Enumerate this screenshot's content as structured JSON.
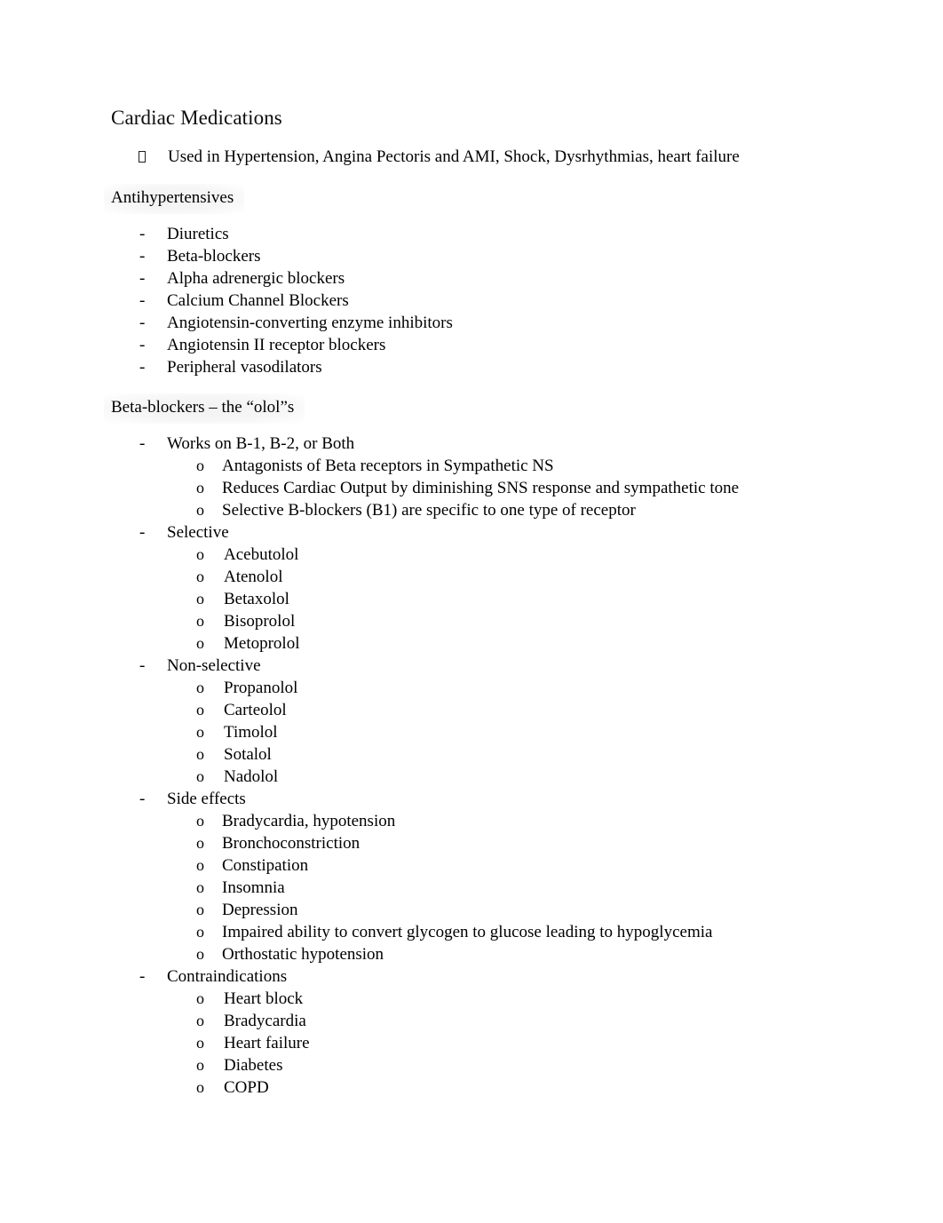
{
  "document": {
    "title": "Cardiac Medications",
    "intro": {
      "marker": "missing-glyph-box",
      "text": "Used in Hypertension, Angina Pectoris and AMI, Shock, Dysrhythmias, heart failure"
    },
    "sections": [
      {
        "heading": "Antihypertensives",
        "heading_shaded": true,
        "items": [
          {
            "marker": "-",
            "text": "Diuretics"
          },
          {
            "marker": "-",
            "text": "Beta-blockers"
          },
          {
            "marker": "-",
            "text": "Alpha adrenergic blockers"
          },
          {
            "marker": "-",
            "text": "Calcium Channel Blockers"
          },
          {
            "marker": "-",
            "text": "Angiotensin-converting enzyme inhibitors"
          },
          {
            "marker": "-",
            "text": "Angiotensin II receptor blockers"
          },
          {
            "marker": "-",
            "text": "Peripheral vasodilators"
          }
        ]
      },
      {
        "heading": "Beta-blockers – the “olol”s",
        "heading_shaded": true,
        "groups": [
          {
            "marker": "-",
            "text": "Works on B-1, B-2, or Both",
            "sub_marker": "o",
            "sub": [
              "Antagonists of Beta receptors in Sympathetic NS",
              "Reduces Cardiac Output by diminishing SNS response and sympathetic tone",
              "Selective B-blockers (B1) are specific to one type of receptor"
            ]
          },
          {
            "marker": "-",
            "text": "Selective",
            "sub_marker": "o",
            "sub": [
              "Acebutolol",
              "Atenolol",
              "Betaxolol",
              "Bisoprolol",
              "Metoprolol"
            ]
          },
          {
            "marker": "-",
            "text": "Non-selective",
            "sub_marker": "o",
            "sub": [
              "Propanolol",
              "Carteolol",
              "Timolol",
              "Sotalol",
              "Nadolol"
            ]
          },
          {
            "marker": "-",
            "text": "Side effects",
            "sub_marker": "o",
            "sub": [
              "Bradycardia, hypotension",
              "Bronchoconstriction",
              "Constipation",
              "Insomnia",
              "Depression",
              "Impaired ability to convert glycogen to glucose leading to hypoglycemia",
              "Orthostatic hypotension"
            ]
          },
          {
            "marker": "-",
            "text": "Contraindications",
            "sub_marker": "o",
            "sub": [
              "Heart block",
              "Bradycardia",
              "Heart failure",
              "Diabetes",
              "COPD"
            ]
          }
        ]
      }
    ]
  }
}
